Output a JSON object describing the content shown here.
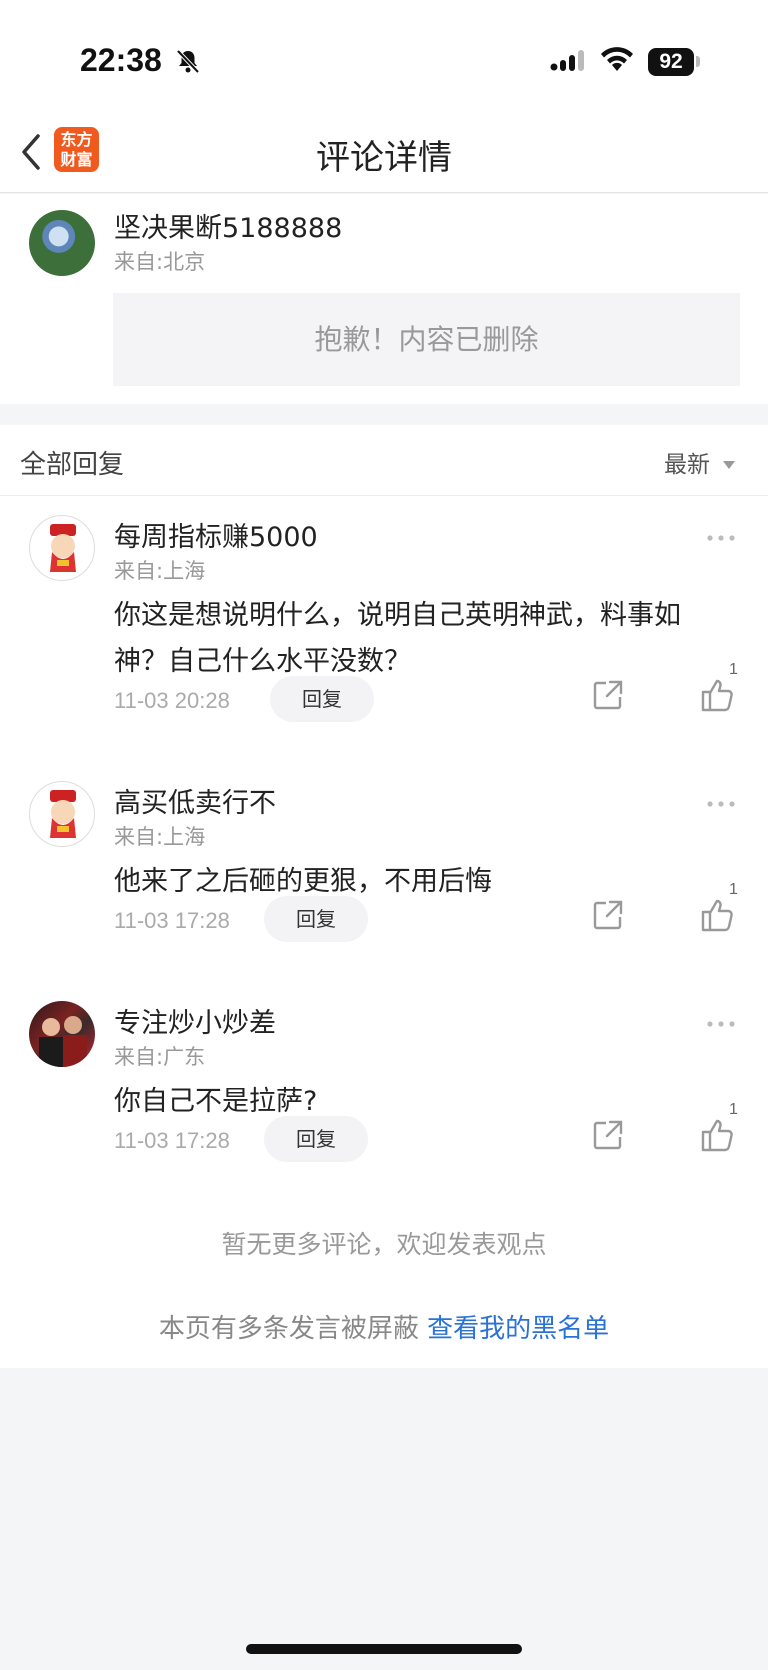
{
  "status": {
    "time": "22:38",
    "battery": "92"
  },
  "nav": {
    "logo_line1": "东方",
    "logo_line2": "财富",
    "title": "评论详情"
  },
  "post": {
    "username": "坚决果断5188888",
    "location": "来自:北京",
    "content": "抱歉！内容已删除"
  },
  "replies_header": {
    "label": "全部回复",
    "sort": "最新"
  },
  "replies": [
    {
      "username": "每周指标赚5000",
      "location": "来自:上海",
      "content": "你这是想说明什么，说明自己英明神武，料事如神？自己什么水平没数？",
      "time": "11-03 20:28",
      "reply_label": "回复",
      "likes": "1"
    },
    {
      "username": "高买低卖行不",
      "location": "来自:上海",
      "content": "他来了之后砸的更狠，不用后悔",
      "time": "11-03 17:28",
      "reply_label": "回复",
      "likes": "1"
    },
    {
      "username": "专注炒小炒差",
      "location": "来自:广东",
      "content": "你自己不是拉萨?",
      "time": "11-03 17:28",
      "reply_label": "回复",
      "likes": "1"
    }
  ],
  "footer": {
    "no_more": "暂无更多评论，欢迎发表观点",
    "blocked_text": "本页有多条发言被屏蔽",
    "blacklist_link": "查看我的黑名单"
  }
}
